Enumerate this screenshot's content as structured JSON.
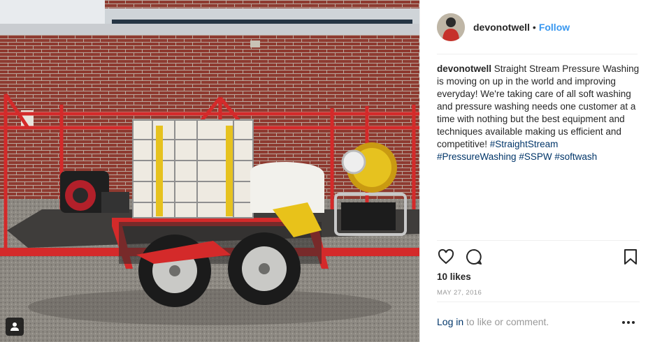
{
  "post": {
    "alt": "Red trailer carrying a pressure washing rig in front of a brick building",
    "username": "devonotwell",
    "separator": "•",
    "follow_label": "Follow",
    "caption": {
      "username": "devonotwell",
      "text": " Straight Stream Pressure Washing is moving on up in the world and improving everyday! We're taking care of all soft washing and pressure washing needs one customer at a time with nothing but the best equipment and techniques available making us efficient and competitive! ",
      "hashtags": [
        "#StraightStream",
        "#PressureWashing",
        "#SSPW",
        "#softwash"
      ]
    },
    "likes": "10 likes",
    "date": "MAY 27, 2016",
    "login_link": "Log in",
    "login_rest": " to like or comment."
  },
  "icons": {
    "like": "heart-icon",
    "comment": "comment-icon",
    "save": "bookmark-icon",
    "more": "more-options-icon",
    "tag": "user-tag-icon"
  },
  "colors": {
    "follow": "#3897f0",
    "hashtag": "#003569",
    "muted": "#999999",
    "trailer_red": "#d42a2a"
  }
}
